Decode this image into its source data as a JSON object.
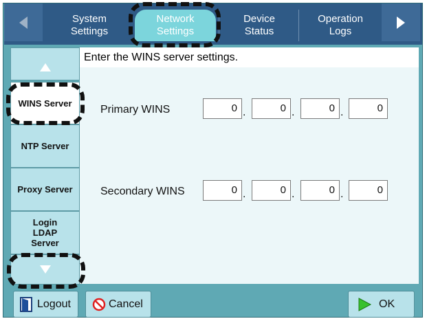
{
  "tabs": [
    {
      "line1": "System",
      "line2": "Settings"
    },
    {
      "line1": "Network",
      "line2": "Settings"
    },
    {
      "line1": "Device",
      "line2": "Status"
    },
    {
      "line1": "Operation",
      "line2": "Logs"
    }
  ],
  "side_menu": {
    "items": [
      "WINS Server",
      "NTP Server",
      "Proxy Server",
      "Login LDAP Server"
    ],
    "selected": "WINS Server"
  },
  "main": {
    "prompt": "Enter the WINS server settings.",
    "primary": {
      "label": "Primary WINS",
      "octets": [
        "0",
        "0",
        "0",
        "0"
      ]
    },
    "secondary": {
      "label": "Secondary WINS",
      "octets": [
        "0",
        "0",
        "0",
        "0"
      ]
    },
    "separator": "."
  },
  "bottom": {
    "logout": "Logout",
    "cancel": "Cancel",
    "ok": "OK"
  },
  "icons": {
    "tab_prev": "left-arrow-icon",
    "tab_next": "right-arrow-icon",
    "menu_up": "up-arrow-icon",
    "menu_down": "down-arrow-icon",
    "logout": "logout-door-icon",
    "cancel": "prohibited-icon",
    "ok": "play-triangle-icon"
  },
  "colors": {
    "tab_bar": "#2f5a86",
    "active_tab": "#7cd5dc",
    "frame": "#5fa9b4",
    "side_button": "#b8e2ea"
  }
}
